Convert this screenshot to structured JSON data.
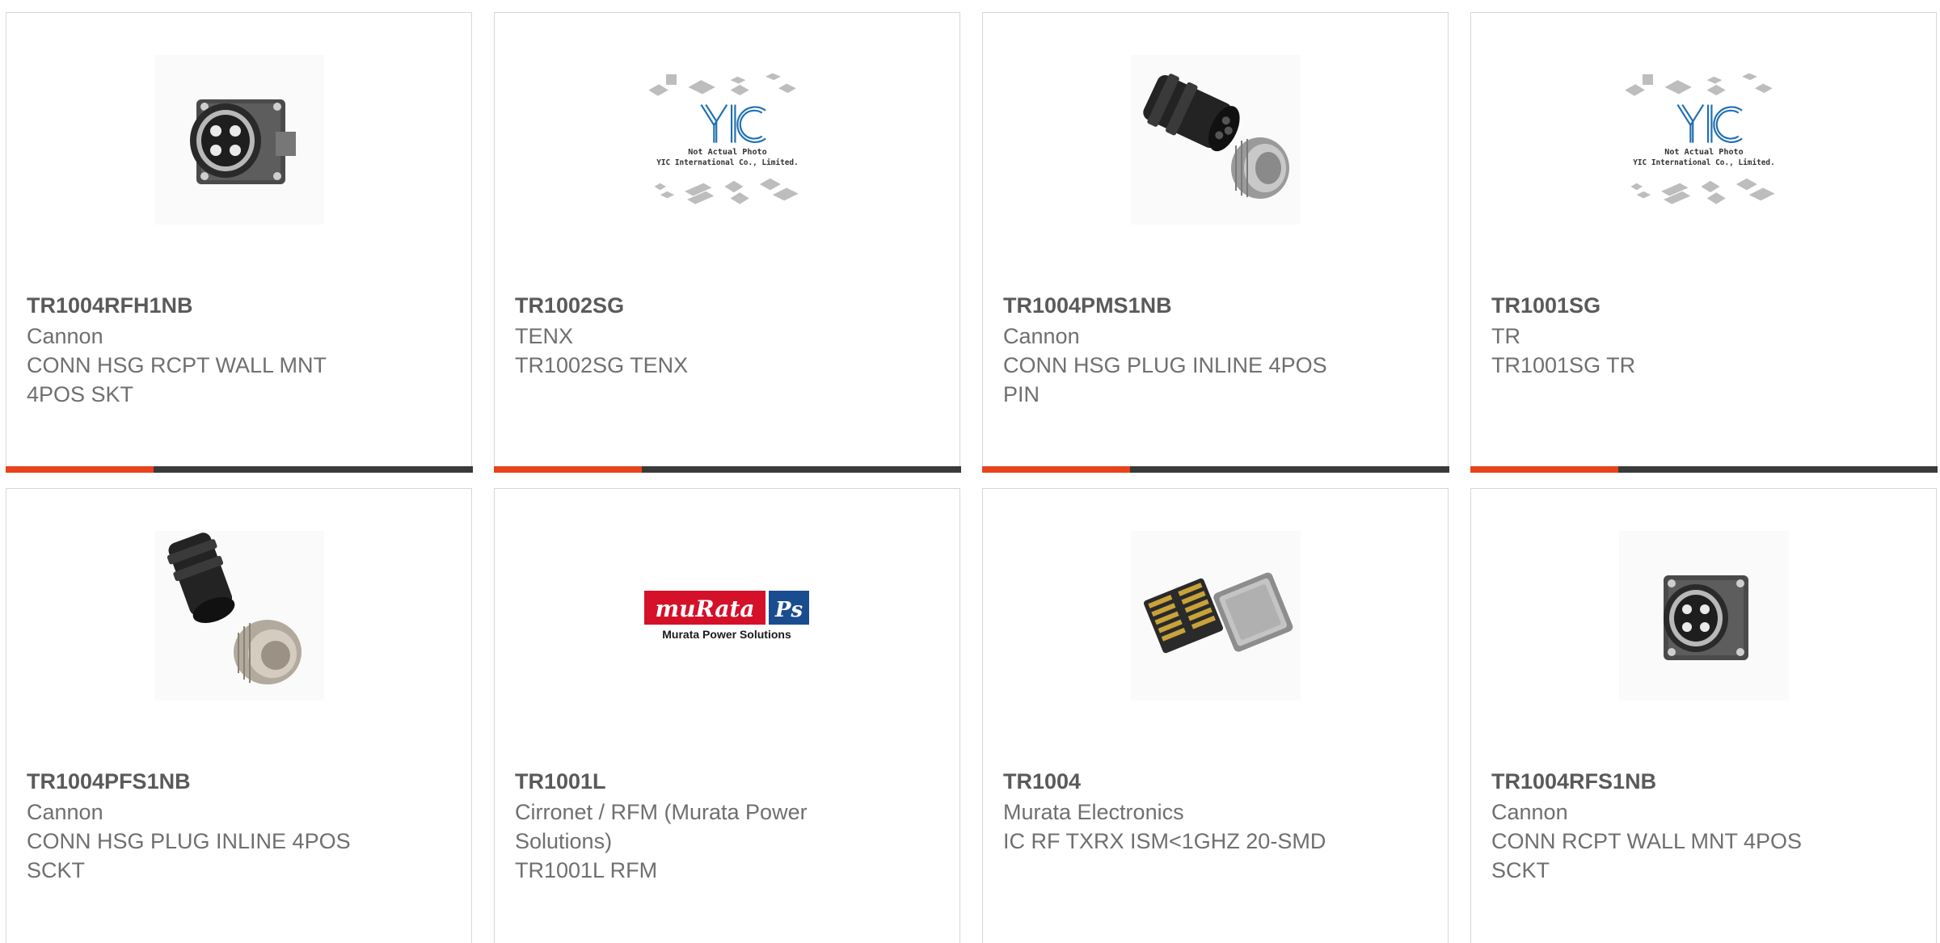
{
  "theme": {
    "accent": "#e8431b",
    "bar_dark": "#3a3a3a",
    "border": "#d6d6d6",
    "text": "#6f6f6f"
  },
  "products": [
    {
      "part_number": "TR1004RFH1NB",
      "manufacturer": "Cannon",
      "description": "CONN HSG RCPT WALL MNT 4POS SKT",
      "image": "connector-receptacle-photo"
    },
    {
      "part_number": "TR1002SG",
      "manufacturer": "TENX",
      "description": "TR1002SG TENX",
      "image": "yic-placeholder",
      "placeholder": {
        "logo": "YIC",
        "line1": "Not Actual Photo",
        "line2": "YIC International Co., Limited."
      }
    },
    {
      "part_number": "TR1004PMS1NB",
      "manufacturer": "Cannon",
      "description": "CONN HSG PLUG INLINE 4POS PIN",
      "image": "connector-plug-photo"
    },
    {
      "part_number": "TR1001SG",
      "manufacturer": "TR",
      "description": "TR1001SG TR",
      "image": "yic-placeholder",
      "placeholder": {
        "logo": "YIC",
        "line1": "Not Actual Photo",
        "line2": "YIC International Co., Limited."
      }
    },
    {
      "part_number": "TR1004PFS1NB",
      "manufacturer": "Cannon",
      "description": "CONN HSG PLUG INLINE 4POS SCKT",
      "image": "connector-plug-socket-photo"
    },
    {
      "part_number": "TR1001L",
      "manufacturer": "Cirronet / RFM (Murata Power Solutions)",
      "description": "TR1001L RFM",
      "image": "murata-logo",
      "logo": {
        "brand": "muRata",
        "badge": "Ps",
        "tagline": "Murata Power Solutions",
        "brand_color": "#d5112a",
        "badge_color": "#1a4d8f"
      }
    },
    {
      "part_number": "TR1004",
      "manufacturer": "Murata Electronics",
      "description": "IC RF TXRX ISM<1GHZ 20-SMD",
      "image": "smd-module-photo"
    },
    {
      "part_number": "TR1004RFS1NB",
      "manufacturer": "Cannon",
      "description": "CONN RCPT WALL MNT 4POS SCKT",
      "image": "connector-receptacle-photo"
    }
  ]
}
